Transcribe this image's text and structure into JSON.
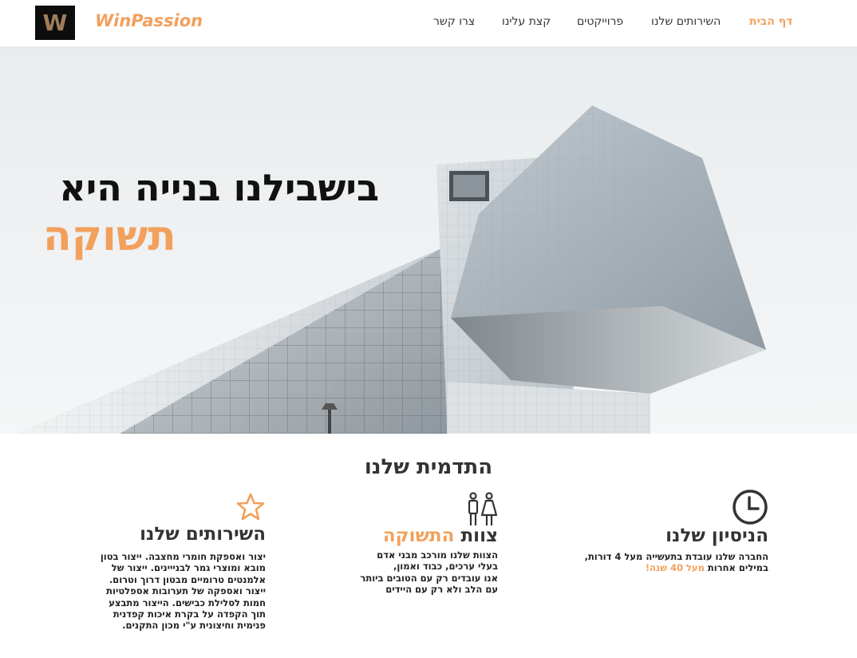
{
  "header": {
    "logo_letter": "W",
    "brand": "WinPassion",
    "nav": [
      {
        "label": "דף הבית",
        "active": true
      },
      {
        "label": "השירותים שלנו",
        "active": false
      },
      {
        "label": "פרוייקטים",
        "active": false
      },
      {
        "label": "קצת עלינו",
        "active": false
      },
      {
        "label": "צרו קשר",
        "active": false
      }
    ]
  },
  "hero": {
    "line1": "בישבילנו בנייה היא",
    "line2": "תשוקה"
  },
  "advantages": {
    "title": "התדמית שלנו",
    "items": [
      {
        "icon": "clock-icon",
        "title": "הניסיון שלנו",
        "text_line1": "החברה שלנו עובדת בתעשייה מעל 4 דורות,",
        "text_line2_plain": "במילים אחרות",
        "text_line2_accent": "מעל 40 שנה!"
      },
      {
        "icon": "people-icon",
        "title_plain": "צוות",
        "title_accent": "התשוקה",
        "text_lines": [
          "הצוות שלנו מורכב מבני אדם",
          "בעלי ערכים, כבוד ואמון,",
          "אנו עובדים רק עם הטובים ביותר",
          "עם הלב ולא רק עם היידים"
        ]
      },
      {
        "icon": "star-icon",
        "title": "השירותים שלנו",
        "text_lines": [
          "יצור ואספקת חומרי מחצבה. ייצור בטון",
          "מובא ומוצרי גמר לבנייינים. ייצור של",
          "אלמנטים טרומיים מבטון דרוך וטרום.",
          "ייצור ואספקה של תערובות אספלטיות",
          "חמות לסלילת כבישים. הייצור מתבצע",
          "תוך הקפדה על בקרת איכות קפדנית",
          "פנימית וחיצונית ע\"י מכון התקנים."
        ]
      }
    ]
  },
  "colors": {
    "accent": "#f2a05c",
    "dark": "#333333"
  }
}
